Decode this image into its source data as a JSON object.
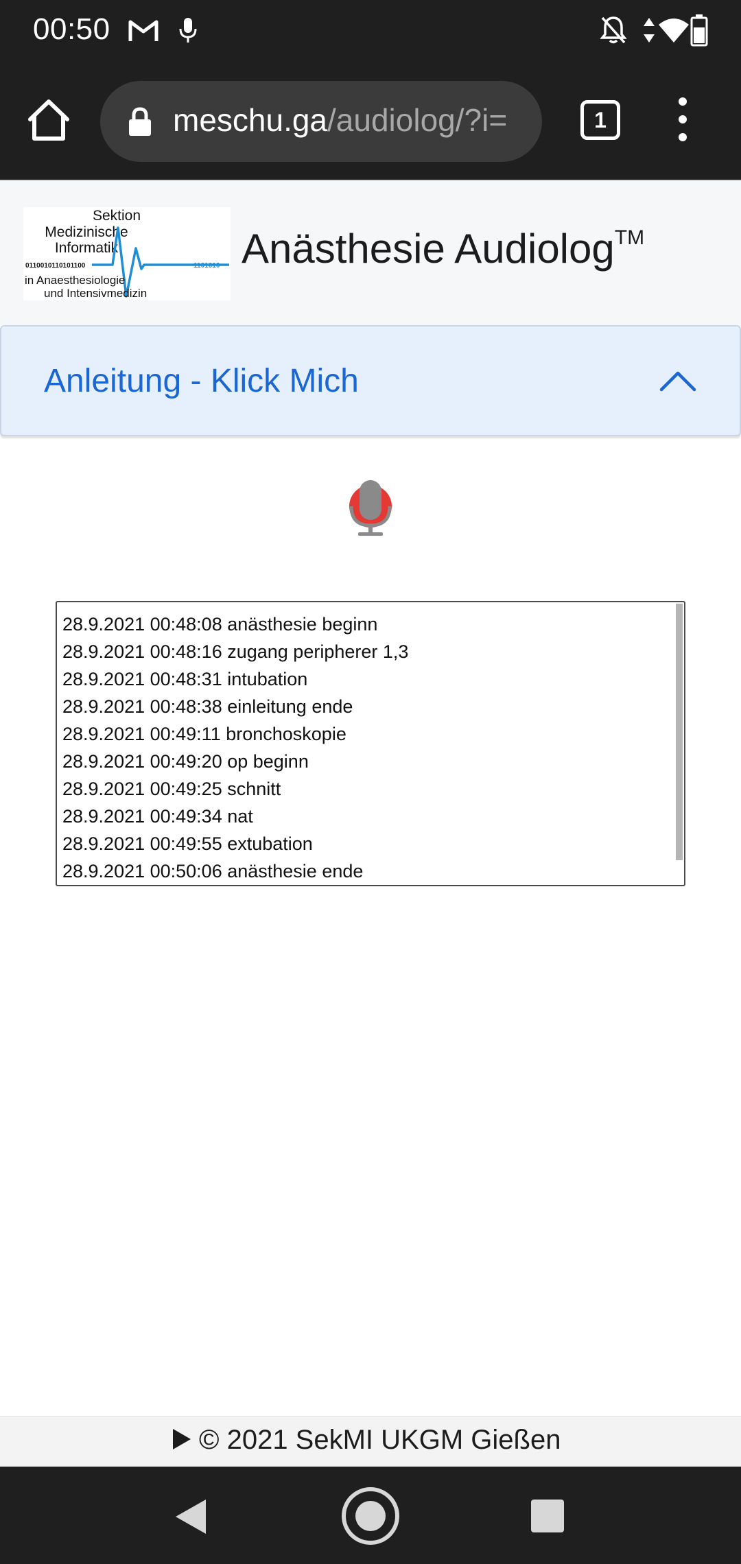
{
  "status_bar": {
    "time": "00:50",
    "icons": [
      "gmail-icon",
      "mic-icon",
      "notifications-off-icon",
      "data-arrows-icon",
      "wifi-icon",
      "battery-icon"
    ]
  },
  "browser": {
    "url_domain": "meschu.ga",
    "url_path": "/audiolog/?i=",
    "tab_count": "1"
  },
  "header": {
    "logo": {
      "line1": "Sektion",
      "line2": "Medizinische",
      "line3": "Informatik",
      "binary_left": "0110010110101100",
      "binary_right": "1101010",
      "line4": "in Anaesthesiologie",
      "line5": "und Intensivmedizin"
    },
    "title": "Anästhesie Audiolog",
    "title_mark": "TM"
  },
  "accordion": {
    "label": "Anleitung - Klick Mich",
    "expanded": false
  },
  "colors": {
    "accent": "#1a66d2",
    "mic_red": "#e53935",
    "logo_blue": "#1e8fd6"
  },
  "log": {
    "entries": [
      "28.9.2021 00:48:08 anästhesie beginn",
      "28.9.2021 00:48:16 zugang peripherer 1,3",
      "28.9.2021 00:48:31 intubation",
      "28.9.2021 00:48:38 einleitung ende",
      "28.9.2021 00:49:11 bronchoskopie",
      "28.9.2021 00:49:20 op beginn",
      "28.9.2021 00:49:25 schnitt",
      "28.9.2021 00:49:34 nat",
      "28.9.2021 00:49:55 extubation",
      "28.9.2021 00:50:06 anästhesie ende"
    ]
  },
  "footer": {
    "text": "© 2021 SekMI UKGM Gießen"
  }
}
